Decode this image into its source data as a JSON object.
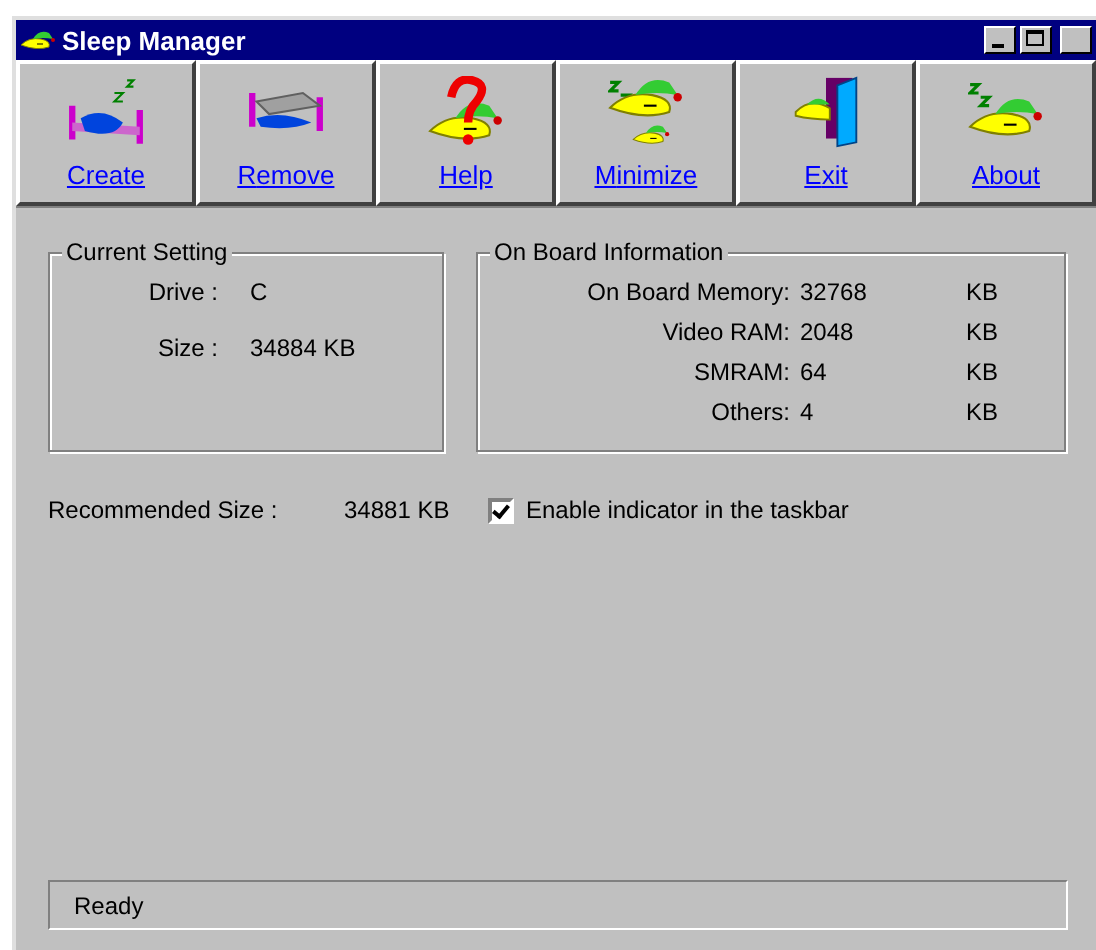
{
  "window": {
    "title": "Sleep Manager"
  },
  "toolbar": [
    {
      "key": "C",
      "after": "reate"
    },
    {
      "key": "R",
      "after": "emove"
    },
    {
      "key": "H",
      "after": "elp"
    },
    {
      "key": "M",
      "after": "inimize"
    },
    {
      "before": "E",
      "key": "x",
      "after": "it"
    },
    {
      "key": "A",
      "after": "bout"
    }
  ],
  "current_setting": {
    "title": "Current Setting",
    "rows": [
      {
        "label": "Drive :",
        "value": "C"
      },
      {
        "label": "Size :",
        "value": "34884 KB"
      }
    ]
  },
  "on_board_information": {
    "title": "On Board Information",
    "rows": [
      {
        "label": "On Board Memory:",
        "value": "32768",
        "unit": "KB"
      },
      {
        "label": "Video RAM:",
        "value": "2048",
        "unit": "KB"
      },
      {
        "label": "SMRAM:",
        "value": "64",
        "unit": "KB"
      },
      {
        "label": "Others:",
        "value": "4",
        "unit": "KB"
      }
    ]
  },
  "recommended": {
    "label": "Recommended Size :",
    "value": "34881 KB"
  },
  "indicator": {
    "label": "Enable indicator in the taskbar",
    "checked": true
  },
  "status_bar": "Ready"
}
